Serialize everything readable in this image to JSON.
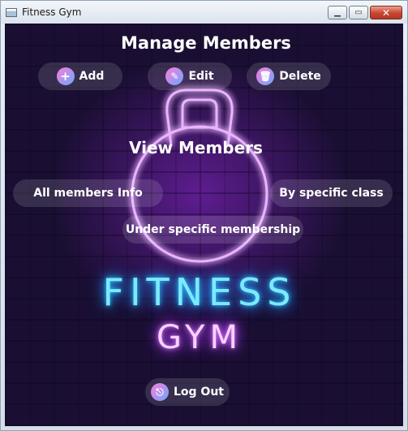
{
  "window": {
    "title": "Fitness Gym"
  },
  "manage": {
    "heading": "Manage Members",
    "add_label": "Add",
    "edit_label": "Edit",
    "delete_label": "Delete"
  },
  "view": {
    "heading": "View Members",
    "all_info_label": "All members Info",
    "by_class_label": "By specific class",
    "by_membership_label": "Under specific membership"
  },
  "logo": {
    "line1": "FITNESS",
    "line2": "GYM"
  },
  "logout_label": "Log Out",
  "colors": {
    "background": "#1a0f33",
    "neon_purple": "#c77dff",
    "neon_cyan": "#5ee7ff",
    "neon_pink": "#f0b8ff"
  }
}
